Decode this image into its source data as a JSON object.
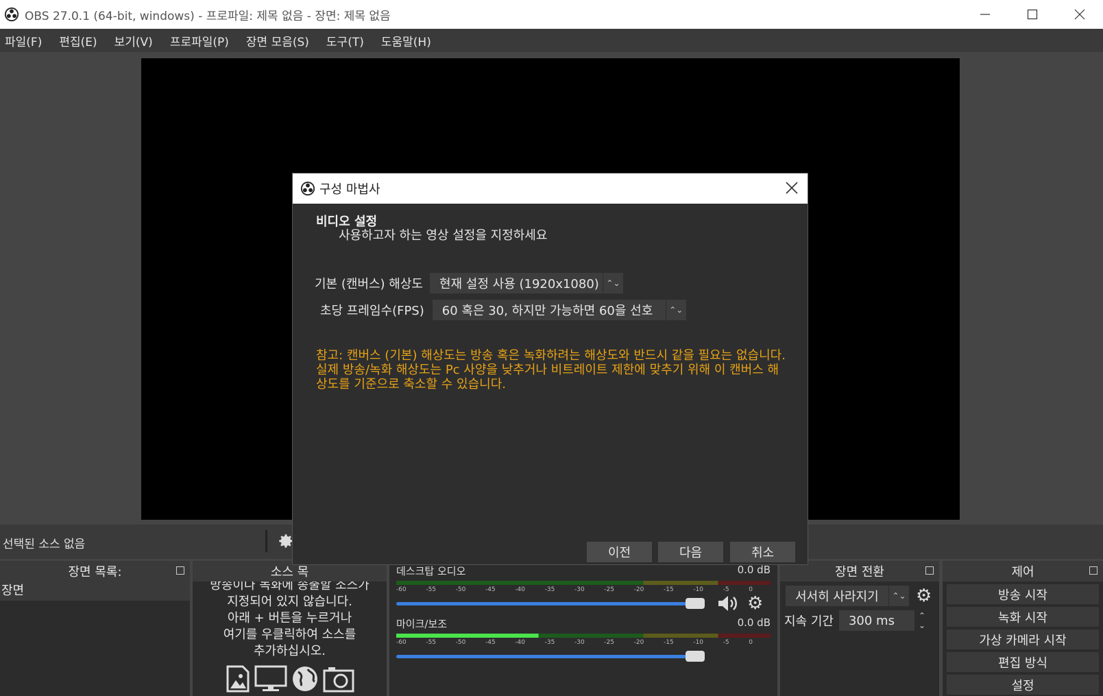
{
  "window": {
    "title": "OBS 27.0.1 (64-bit, windows) - 프로파일: 제목 없음 - 장면: 제목 없음",
    "minimize": "—",
    "maximize": "☐",
    "close": "✕"
  },
  "menu": {
    "file": "파일(F)",
    "edit": "편집(E)",
    "view": "보기(V)",
    "profile": "프로파일(P)",
    "scene_collection": "장면 모음(S)",
    "tools": "도구(T)",
    "help": "도움말(H)"
  },
  "source_bar": {
    "no_source": "선택된 소스 없음"
  },
  "scenes_dock": {
    "title": "장면 목록:",
    "items": [
      "장면"
    ]
  },
  "sources_dock": {
    "title": "소스 목",
    "hint_lines": [
      "방송이나 녹화에 송출할 소스가",
      "지정되어 있지 않습니다.",
      "아래 + 버튼을 누르거나",
      "여기를 우클릭하여 소스를",
      "추가하십시오."
    ]
  },
  "mixer": {
    "channels": [
      {
        "name": "데스크탑 오디오",
        "level": "0.0 dB"
      },
      {
        "name": "마이크/보조",
        "level": "0.0 dB"
      }
    ],
    "ticks": [
      "-60",
      "-55",
      "-50",
      "-45",
      "-40",
      "-35",
      "-30",
      "-25",
      "-20",
      "-15",
      "-10",
      "-5",
      "0"
    ]
  },
  "transitions_dock": {
    "title": "장면 전환",
    "transition": "서서히 사라지기",
    "duration_label": "지속 기간",
    "duration_value": "300 ms"
  },
  "controls_dock": {
    "title": "제어",
    "start_streaming": "방송 시작",
    "start_recording": "녹화 시작",
    "start_virtualcam": "가상 카메라 시작",
    "studio_mode": "편집 방식",
    "settings": "설정"
  },
  "wizard": {
    "title": "구성 마법사",
    "heading": "비디오 설정",
    "subheading": "사용하고자 하는 영상 설정을 지정하세요",
    "base_res_label": "기본 (캔버스) 해상도",
    "base_res_value": "현재 설정 사용 (1920x1080)",
    "fps_label": "초당 프레임수(FPS)",
    "fps_value": "60 혹은 30, 하지만 가능하면 60을 선호",
    "note": "참고: 캔버스 (기본) 해상도는 방송 혹은 녹화하려는 해상도와 반드시 같을 필요는 없습니다. 실제 방송/녹화 해상도는 Pc 사양을 낮추거나 비트레이트 제한에 맞추기 위해 이 캔버스 해상도를 기준으로 축소할 수 있습니다.",
    "back": "이전",
    "next": "다음",
    "cancel": "취소"
  },
  "colors": {
    "note_orange": "#e8a316",
    "volume_blue": "#3b7fe0",
    "meter_green": "#4be34b"
  }
}
